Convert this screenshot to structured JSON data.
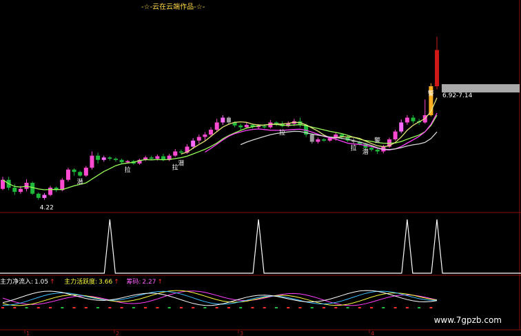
{
  "header": {
    "title": "-☆-云在云端作品-☆-"
  },
  "colors": {
    "bg": "#000000",
    "up": "#ff4ad2",
    "up_alt": "#ff6aff",
    "down": "#1fb83a",
    "neutral": "#9a9a9a",
    "ma_fast": "#ff40ff",
    "ma_mid": "#e3e37a",
    "ma_slow": "#9aff5a",
    "ma_white": "#d8d8d8",
    "divider": "#8a1010"
  },
  "main_annotations": {
    "low_label": "4.22",
    "price_label": "6.92",
    "price_label2": "7.14",
    "marks": [
      "潜",
      "拉",
      "拉",
      "潜",
      "拉",
      "拉",
      "潜",
      "警",
      "警"
    ]
  },
  "indicator": {
    "items": [
      {
        "label": "主力净流入:",
        "value": "1.05",
        "arrow": "↑"
      },
      {
        "label": "主力活跃度:",
        "value": "3.66",
        "arrow": "↑"
      },
      {
        "label": "筹码:",
        "value": "2.27",
        "arrow": "↑"
      }
    ]
  },
  "axis": {
    "ticks": [
      "1",
      "2",
      "3",
      "4"
    ]
  },
  "watermark": "www.7gpzb.com",
  "chart_data": {
    "type": "candlestick",
    "candles": [
      [
        4.4,
        4.55,
        4.38,
        4.6
      ],
      [
        4.55,
        4.42,
        4.38,
        4.6
      ],
      [
        4.42,
        4.35,
        4.3,
        4.48
      ],
      [
        4.35,
        4.4,
        4.32,
        4.45
      ],
      [
        4.4,
        4.5,
        4.36,
        4.56
      ],
      [
        4.5,
        4.32,
        4.3,
        4.52
      ],
      [
        4.32,
        4.25,
        4.22,
        4.34
      ],
      [
        4.25,
        4.3,
        4.22,
        4.33
      ],
      [
        4.3,
        4.42,
        4.28,
        4.45
      ],
      [
        4.42,
        4.38,
        4.35,
        4.44
      ],
      [
        4.38,
        4.55,
        4.36,
        4.58
      ],
      [
        4.55,
        4.72,
        4.52,
        4.75
      ],
      [
        4.72,
        4.68,
        4.62,
        4.74
      ],
      [
        4.68,
        4.62,
        4.6,
        4.7
      ],
      [
        4.62,
        4.75,
        4.6,
        4.78
      ],
      [
        4.75,
        4.95,
        4.72,
        5.02
      ],
      [
        4.95,
        4.88,
        4.82,
        5.0
      ],
      [
        4.88,
        4.92,
        4.85,
        4.95
      ],
      [
        4.92,
        4.9,
        4.87,
        4.94
      ],
      [
        4.9,
        4.88,
        4.85,
        4.92
      ],
      [
        4.88,
        4.84,
        4.82,
        4.9
      ],
      [
        4.84,
        4.86,
        4.82,
        4.88
      ],
      [
        4.86,
        4.82,
        4.8,
        4.88
      ],
      [
        4.82,
        4.88,
        4.8,
        4.9
      ],
      [
        4.88,
        4.92,
        4.86,
        4.95
      ],
      [
        4.92,
        4.9,
        4.88,
        4.95
      ],
      [
        4.9,
        4.94,
        4.87,
        4.97
      ],
      [
        4.94,
        4.88,
        4.86,
        4.98
      ],
      [
        4.88,
        4.95,
        4.86,
        4.98
      ],
      [
        4.95,
        5.02,
        4.93,
        5.06
      ],
      [
        5.02,
        5.0,
        4.97,
        5.05
      ],
      [
        5.0,
        5.1,
        4.98,
        5.14
      ],
      [
        5.1,
        5.2,
        5.06,
        5.24
      ],
      [
        5.2,
        5.26,
        5.15,
        5.3
      ],
      [
        5.26,
        5.3,
        5.2,
        5.34
      ],
      [
        5.3,
        5.38,
        5.26,
        5.42
      ],
      [
        5.38,
        5.5,
        5.34,
        5.56
      ],
      [
        5.5,
        5.58,
        5.46,
        5.62
      ],
      [
        5.58,
        5.5,
        5.46,
        5.6
      ],
      [
        5.5,
        5.45,
        5.42,
        5.52
      ],
      [
        5.45,
        5.42,
        5.38,
        5.48
      ],
      [
        5.42,
        5.46,
        5.4,
        5.5
      ],
      [
        5.46,
        5.43,
        5.4,
        5.48
      ],
      [
        5.43,
        5.44,
        5.4,
        5.47
      ],
      [
        5.44,
        5.42,
        5.4,
        5.47
      ],
      [
        5.42,
        5.5,
        5.4,
        5.54
      ],
      [
        5.5,
        5.48,
        5.44,
        5.52
      ],
      [
        5.48,
        5.44,
        5.42,
        5.52
      ],
      [
        5.44,
        5.48,
        5.42,
        5.52
      ],
      [
        5.48,
        5.52,
        5.44,
        5.56
      ],
      [
        5.52,
        5.46,
        5.42,
        5.58
      ],
      [
        5.46,
        5.3,
        5.26,
        5.48
      ],
      [
        5.3,
        5.18,
        5.15,
        5.32
      ],
      [
        5.18,
        5.22,
        5.15,
        5.25
      ],
      [
        5.22,
        5.2,
        5.18,
        5.24
      ],
      [
        5.2,
        5.24,
        5.18,
        5.26
      ],
      [
        5.24,
        5.3,
        5.2,
        5.34
      ],
      [
        5.3,
        5.26,
        5.22,
        5.32
      ],
      [
        5.26,
        5.2,
        5.18,
        5.28
      ],
      [
        5.2,
        5.18,
        5.15,
        5.24
      ],
      [
        5.18,
        5.14,
        5.12,
        5.2
      ],
      [
        5.14,
        5.08,
        5.05,
        5.16
      ],
      [
        5.08,
        5.05,
        5.02,
        5.1
      ],
      [
        5.05,
        5.02,
        4.98,
        5.08
      ],
      [
        5.02,
        5.1,
        4.99,
        5.13
      ],
      [
        5.1,
        5.22,
        5.08,
        5.25
      ],
      [
        5.22,
        5.35,
        5.2,
        5.38
      ],
      [
        5.35,
        5.5,
        5.32,
        5.55
      ],
      [
        5.5,
        5.58,
        5.46,
        5.62
      ],
      [
        5.58,
        5.52,
        5.48,
        5.62
      ],
      [
        5.52,
        5.5,
        5.46,
        5.56
      ],
      [
        5.5,
        5.62,
        5.48,
        5.88
      ],
      [
        5.62,
        6.1,
        5.6,
        6.15
      ],
      [
        6.1,
        6.7,
        6.05,
        6.92
      ]
    ],
    "ylim": [
      4.1,
      7.3
    ],
    "osc_peaks": [
      18,
      43,
      68,
      73
    ]
  }
}
